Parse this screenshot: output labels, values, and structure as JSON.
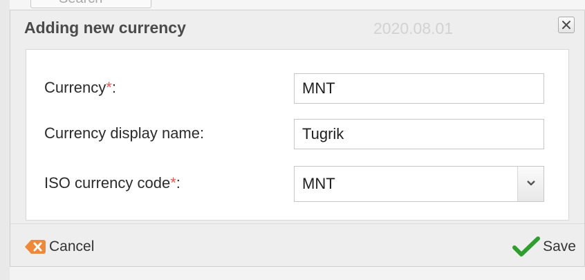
{
  "background": {
    "search_placeholder": "Search",
    "date_text": "2020.08.01"
  },
  "dialog": {
    "title": "Adding new currency",
    "close_icon": "close-icon",
    "fields": {
      "currency": {
        "label": "Currency",
        "required_mark": "*",
        "suffix": ":",
        "value": "MNT"
      },
      "display_name": {
        "label": "Currency display name:",
        "value": "Tugrik"
      },
      "iso_code": {
        "label": "ISO currency code",
        "required_mark": "*",
        "suffix": ":",
        "selected": "MNT",
        "dropdown_icon": "chevron-down-icon"
      }
    },
    "footer": {
      "cancel_label": "Cancel",
      "cancel_icon": "cancel-x-icon",
      "save_label": "Save",
      "save_icon": "checkmark-icon"
    }
  },
  "colors": {
    "required": "#f05454",
    "cancel_icon": "#f0883a",
    "save_icon": "#2e9e2e",
    "dialog_bg": "#eeeeee"
  }
}
